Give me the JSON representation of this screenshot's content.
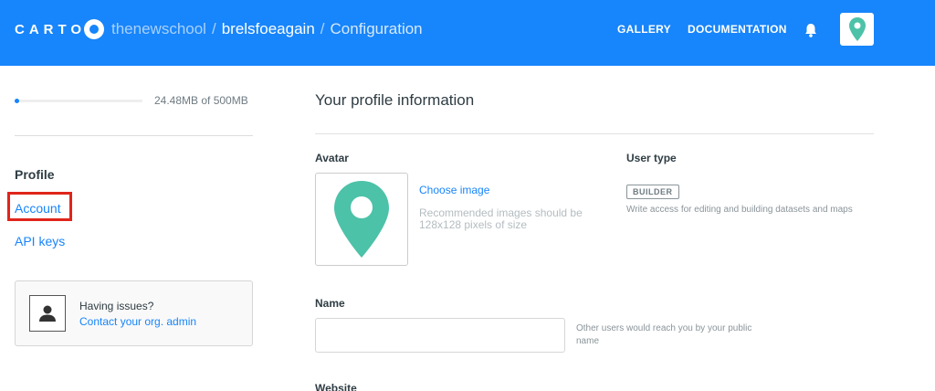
{
  "header": {
    "logo_text": "CARTO",
    "breadcrumb": {
      "org": "thenewschool",
      "user": "brelsfoeagain",
      "page": "Configuration",
      "separator": "/"
    },
    "nav": [
      {
        "label": "GALLERY"
      },
      {
        "label": "DOCUMENTATION"
      }
    ],
    "bell_icon": "bell-icon",
    "avatar_icon": "map-pin-icon",
    "colors": {
      "header_bg": "#1785fb",
      "avatar_pin": "#4cc2a8"
    }
  },
  "sidebar": {
    "storage": {
      "used_label": "24.48MB of 500MB",
      "used_fraction": 0.049
    },
    "section_title": "Profile",
    "items": [
      {
        "label": "Account",
        "highlighted": true
      },
      {
        "label": "API keys"
      }
    ],
    "help": {
      "question": "Having issues?",
      "link": "Contact your org. admin",
      "icon": "user-silhouette-icon"
    }
  },
  "main": {
    "title": "Your profile information",
    "avatar": {
      "label": "Avatar",
      "choose_label": "Choose image",
      "hint": "Recommended images should be 128x128 pixels of size"
    },
    "user_type": {
      "label": "User type",
      "badge": "BUILDER",
      "description": "Write access for editing and building datasets and maps"
    },
    "name": {
      "label": "Name",
      "value": "",
      "placeholder": "",
      "hint": "Other users would reach you by your public name"
    },
    "website": {
      "label": "Website"
    }
  }
}
